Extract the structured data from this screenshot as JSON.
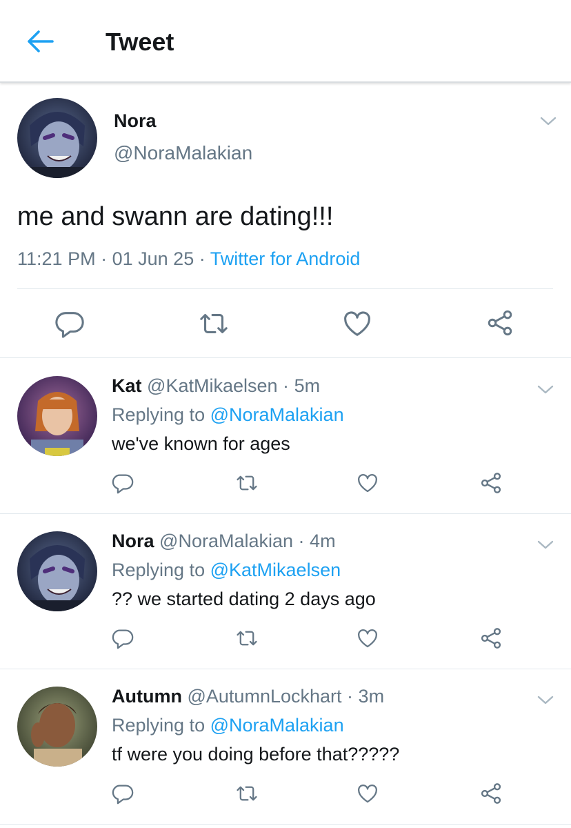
{
  "header": {
    "title": "Tweet",
    "back_icon": "arrow-left-icon"
  },
  "colors": {
    "accent": "#1da1f2",
    "secondary_text": "#657786",
    "primary_text": "#14171a",
    "divider": "#e1e8ed"
  },
  "main_tweet": {
    "name": "Nora",
    "handle": "@NoraMalakian",
    "text": "me and swann are dating!!!",
    "time": "11:21 PM",
    "date": "01 Jun 25",
    "separator": "·",
    "source": "Twitter for Android",
    "actions": [
      "reply-icon",
      "retweet-icon",
      "like-icon",
      "share-icon"
    ]
  },
  "replies": [
    {
      "name": "Kat",
      "handle": "@KatMikaelsen",
      "time": "5m",
      "replying_prefix": "Replying to",
      "replying_to": "@NoraMalakian",
      "text": "we've known for ages"
    },
    {
      "name": "Nora",
      "handle": "@NoraMalakian",
      "time": "4m",
      "replying_prefix": "Replying to",
      "replying_to": "@KatMikaelsen",
      "text": "?? we started dating 2 days ago"
    },
    {
      "name": "Autumn",
      "handle": "@AutumnLockhart",
      "time": "3m",
      "replying_prefix": "Replying to",
      "replying_to": "@NoraMalakian",
      "text": "tf were you doing before that?????"
    }
  ]
}
